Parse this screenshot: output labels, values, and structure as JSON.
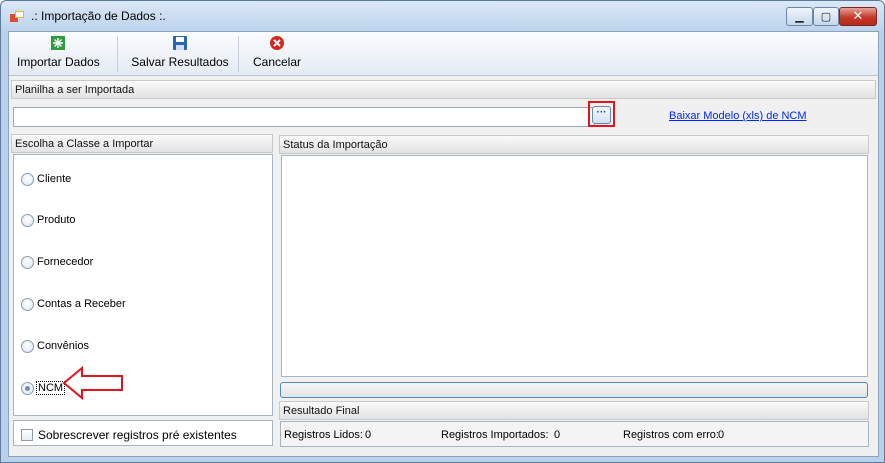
{
  "window": {
    "title": ".: Importação de Dados :.",
    "buttons": {
      "minimize": "▁",
      "maximize": "▢",
      "close": "✕"
    }
  },
  "toolbar": {
    "import_label": "Importar Dados",
    "save_label": "Salvar Resultados",
    "cancel_label": "Cancelar",
    "icons": [
      "import-icon",
      "save-icon",
      "cancel-icon"
    ]
  },
  "spreadsheet": {
    "section_title": "Planilha a ser Importada",
    "path_value": "",
    "browse_label": "···",
    "download_link": "Baixar Modelo (xls) de NCM"
  },
  "classes": {
    "section_title": "Escolha a Classe a Importar",
    "options": [
      {
        "label": "Cliente",
        "checked": false
      },
      {
        "label": "Produto",
        "checked": false
      },
      {
        "label": "Fornecedor",
        "checked": false
      },
      {
        "label": "Contas a Receber",
        "checked": false
      },
      {
        "label": "Convênios",
        "checked": false
      },
      {
        "label": "NCM",
        "checked": true
      }
    ],
    "overwrite_label": "Sobrescrever registros pré existentes",
    "overwrite_checked": false
  },
  "status": {
    "section_title": "Status da Importação",
    "progress": 0
  },
  "result": {
    "section_title": "Resultado Final",
    "read_label": "Registros Lidos:",
    "read_value": "0",
    "imported_label": "Registros Importados:",
    "imported_value": "0",
    "error_label": "Registros com erro:",
    "error_value": "0"
  },
  "colors": {
    "title_bar": "#bcd3ec",
    "highlight": "#e2141c",
    "link": "#0026ff",
    "progress_border": "#4f8bbf"
  }
}
